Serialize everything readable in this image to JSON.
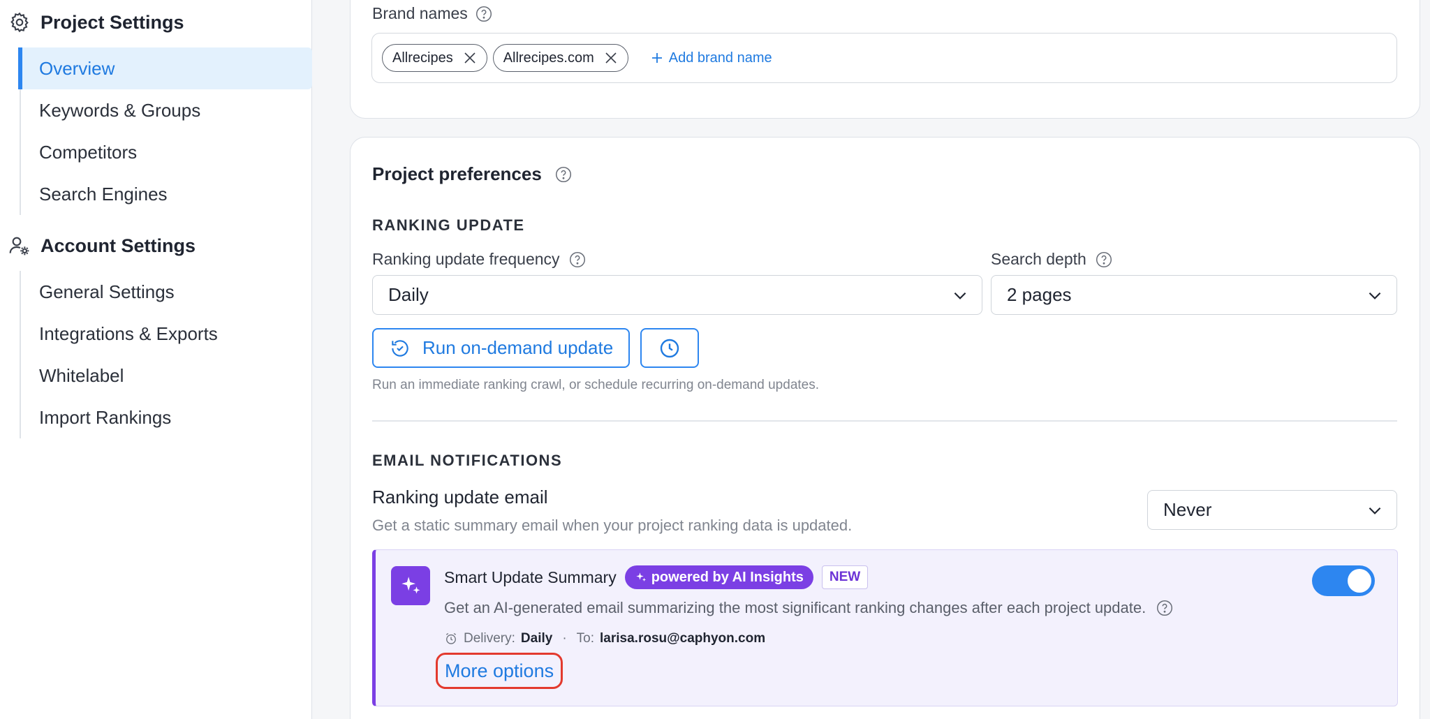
{
  "sidebar": {
    "project_settings": {
      "title": "Project Settings",
      "items": [
        {
          "label": "Overview",
          "active": true
        },
        {
          "label": "Keywords & Groups"
        },
        {
          "label": "Competitors"
        },
        {
          "label": "Search Engines"
        }
      ]
    },
    "account_settings": {
      "title": "Account Settings",
      "items": [
        {
          "label": "General Settings"
        },
        {
          "label": "Integrations & Exports"
        },
        {
          "label": "Whitelabel"
        },
        {
          "label": "Import Rankings"
        }
      ]
    }
  },
  "brand": {
    "label": "Brand names",
    "chips": [
      "Allrecipes",
      "Allrecipes.com"
    ],
    "add_label": "Add brand name"
  },
  "preferences": {
    "title": "Project preferences",
    "ranking_update": {
      "heading": "RANKING UPDATE",
      "frequency_label": "Ranking update frequency",
      "frequency_value": "Daily",
      "depth_label": "Search depth",
      "depth_value": "2 pages",
      "run_button": "Run on-demand update",
      "hint": "Run an immediate ranking crawl, or schedule recurring on-demand updates."
    },
    "email": {
      "heading": "EMAIL NOTIFICATIONS",
      "ranking_email_label": "Ranking update email",
      "ranking_email_desc": "Get a static summary email when your project ranking data is updated.",
      "ranking_email_value": "Never",
      "smart": {
        "title": "Smart Update Summary",
        "badge_ai": "powered by AI Insights",
        "badge_new": "NEW",
        "description": "Get an AI-generated email summarizing the most significant ranking changes after each project update.",
        "delivery_label": "Delivery:",
        "delivery_value": "Daily",
        "separator": "·",
        "to_label": "To:",
        "to_value": "larisa.rosu@caphyon.com",
        "more_options": "More options",
        "enabled": true
      }
    }
  },
  "colors": {
    "accent": "#2d86f0",
    "ai_purple": "#7b3fe4",
    "highlight_red": "#e33a2e"
  }
}
